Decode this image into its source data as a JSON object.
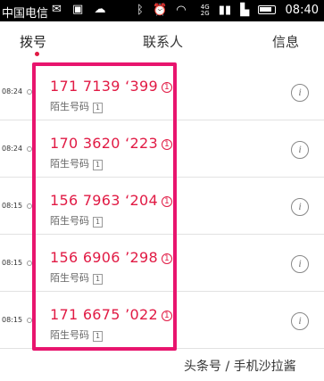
{
  "status_bar": {
    "carrier": "中国电信",
    "signal_4g": "4G",
    "signal_2g": "2G",
    "time": "08:40"
  },
  "tabs": [
    {
      "label": "拨号",
      "active": true
    },
    {
      "label": "联系人",
      "active": false
    },
    {
      "label": "信息",
      "active": false
    }
  ],
  "accent_color": "#e11a44",
  "highlight_color": "#e8156e",
  "calls": [
    {
      "time": "08:24",
      "number": "171 7139 ‘399",
      "sim": "1",
      "label": "陌生号码",
      "sim_badge": "1"
    },
    {
      "time": "08:24",
      "number": "170 3620 ‘223",
      "sim": "1",
      "label": "陌生号码",
      "sim_badge": "1"
    },
    {
      "time": "08:15",
      "number": "156 7963 ‘204",
      "sim": "1",
      "label": "陌生号码",
      "sim_badge": "1"
    },
    {
      "time": "08:15",
      "number": "156 6906 ’298",
      "sim": "1",
      "label": "陌生号码",
      "sim_badge": "1"
    },
    {
      "time": "08:15",
      "number": "171 6675 ’022",
      "sim": "1",
      "label": "陌生号码",
      "sim_badge": "1"
    }
  ],
  "info_icon_glyph": "i",
  "watermark": "头条号 / 手机沙拉酱"
}
